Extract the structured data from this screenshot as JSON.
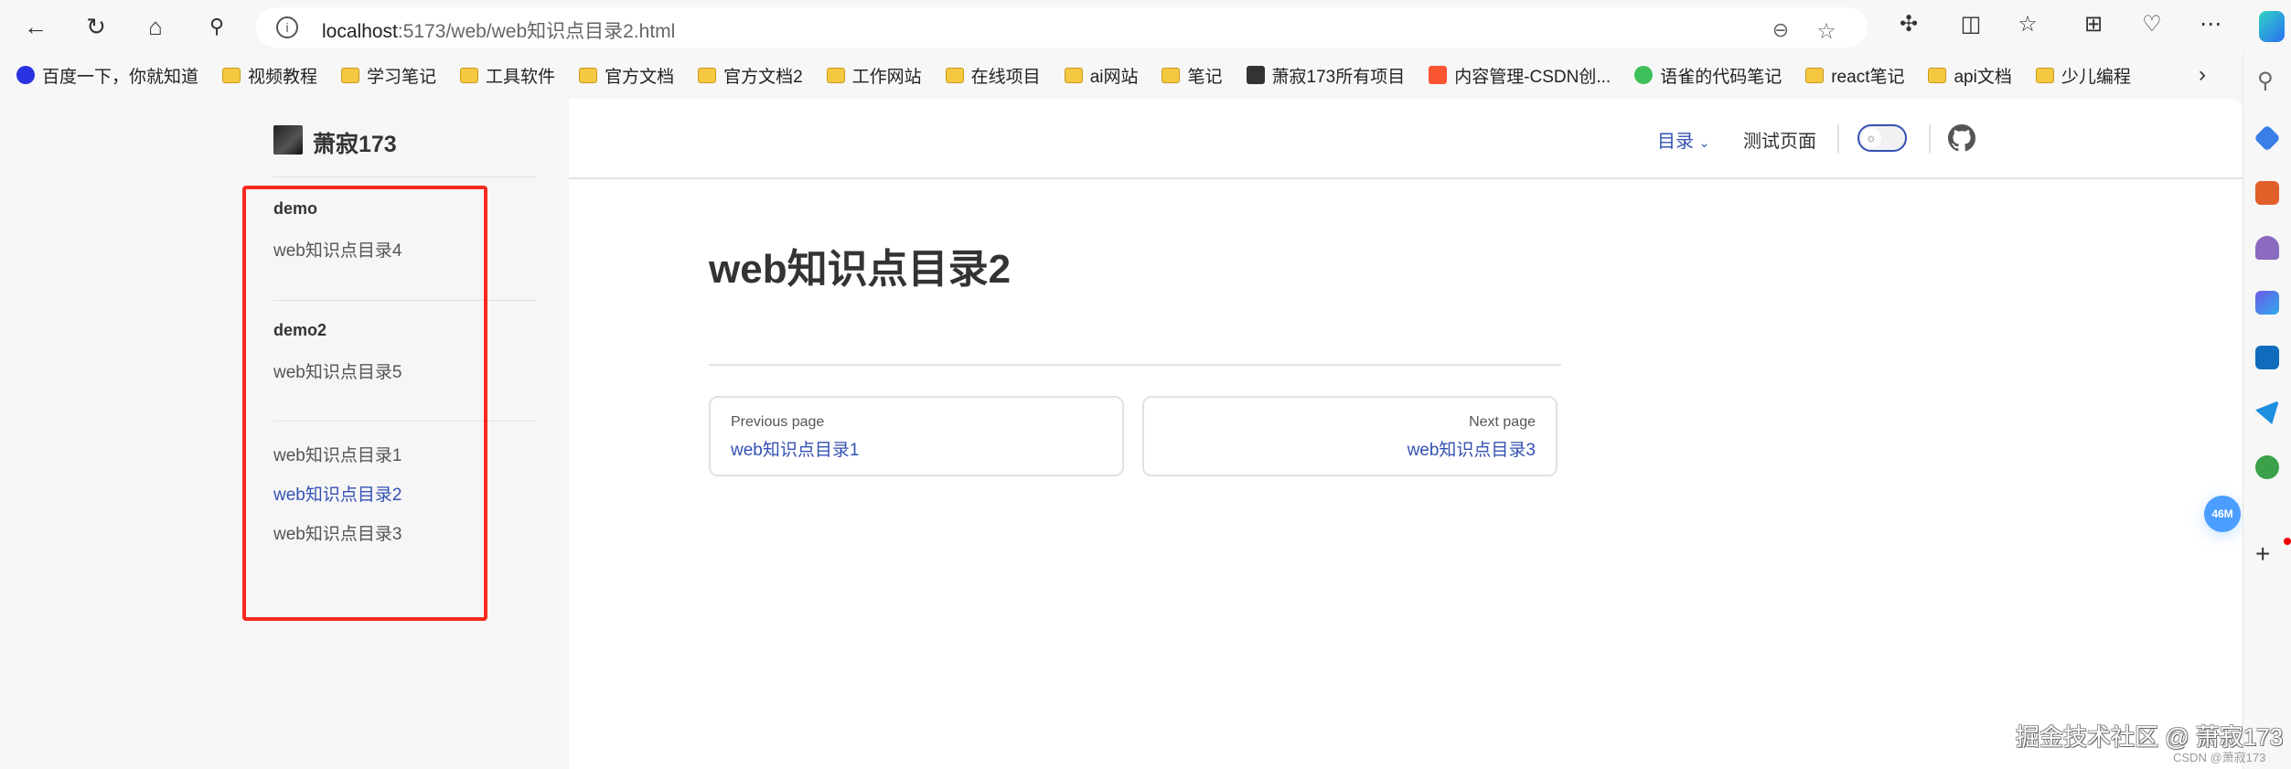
{
  "browser": {
    "url_host": "localhost",
    "url_path": ":5173/web/web知识点目录2.html",
    "bookmarks": [
      {
        "label": "百度一下，你就知道",
        "icon": "baidu-icon"
      },
      {
        "label": "视频教程",
        "icon": "folder-icon"
      },
      {
        "label": "学习笔记",
        "icon": "folder-icon"
      },
      {
        "label": "工具软件",
        "icon": "folder-icon"
      },
      {
        "label": "官方文档",
        "icon": "folder-icon"
      },
      {
        "label": "官方文档2",
        "icon": "folder-icon"
      },
      {
        "label": "工作网站",
        "icon": "folder-icon"
      },
      {
        "label": "在线项目",
        "icon": "folder-icon"
      },
      {
        "label": "ai网站",
        "icon": "folder-icon"
      },
      {
        "label": "笔记",
        "icon": "folder-icon"
      },
      {
        "label": "萧寂173所有项目",
        "icon": "avatar-icon"
      },
      {
        "label": "内容管理-CSDN创...",
        "icon": "csdn-icon"
      },
      {
        "label": "语雀的代码笔记",
        "icon": "yuque-icon"
      },
      {
        "label": "react笔记",
        "icon": "folder-icon"
      },
      {
        "label": "api文档",
        "icon": "folder-icon"
      },
      {
        "label": "少儿编程",
        "icon": "folder-icon"
      }
    ]
  },
  "site": {
    "brand": "萧寂173",
    "nav": {
      "menu": "目录",
      "test": "测试页面"
    },
    "sidebar": {
      "groups": [
        {
          "title": "demo",
          "items": [
            "web知识点目录4"
          ]
        },
        {
          "title": "demo2",
          "items": [
            "web知识点目录5"
          ]
        },
        {
          "items": [
            "web知识点目录1",
            "web知识点目录2",
            "web知识点目录3"
          ]
        }
      ]
    },
    "page_title": "web知识点目录2",
    "prev": {
      "label": "Previous page",
      "title": "web知识点目录1"
    },
    "next": {
      "label": "Next page",
      "title": "web知识点目录3"
    },
    "badge": "46M"
  },
  "watermark": {
    "main": "掘金技术社区 @ 萧寂173",
    "sub": "CSDN @萧寂173"
  },
  "colors": {
    "brand": "#3451b2",
    "highlight": "#f52a1f"
  }
}
